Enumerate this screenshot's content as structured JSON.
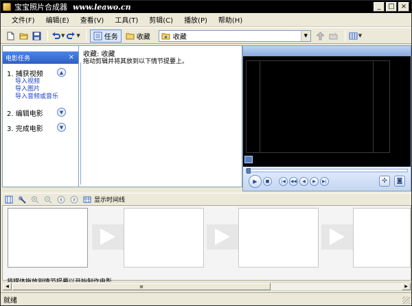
{
  "window": {
    "title": "宝宝照片合成器",
    "site": "www.leawo.cn",
    "controls": [
      "_",
      "□",
      "×"
    ]
  },
  "menu": [
    "文件(F)",
    "编辑(E)",
    "查看(V)",
    "工具(T)",
    "剪辑(C)",
    "播放(P)",
    "帮助(H)"
  ],
  "toolbar": {
    "tasks_label": "任务",
    "favorites_label": "收藏",
    "collection_value": "收藏"
  },
  "taskpane": {
    "header": "电影任务",
    "close": "×",
    "sections": [
      {
        "title": "1.  捕获视频",
        "expanded": true,
        "links": [
          "导入视频",
          "导入图片",
          "导入音频或音乐"
        ]
      },
      {
        "title": "2.  编辑电影",
        "expanded": false,
        "links": []
      },
      {
        "title": "3.  完成电影",
        "expanded": false,
        "links": []
      }
    ]
  },
  "collection": {
    "title": "收藏: 收藏",
    "subtitle": "拖动剪辑并将其放到以下情节提要上。"
  },
  "storyboard": {
    "show_timeline": "显示时间线",
    "hint": "将媒体拖放到情节提要以开始制作电影。"
  },
  "status": {
    "text": "就绪"
  },
  "colors": {
    "title_bar": "#000000",
    "task_header": "#2f5fc4",
    "link": "#1a3fc4",
    "chrome": "#ece9d8"
  }
}
